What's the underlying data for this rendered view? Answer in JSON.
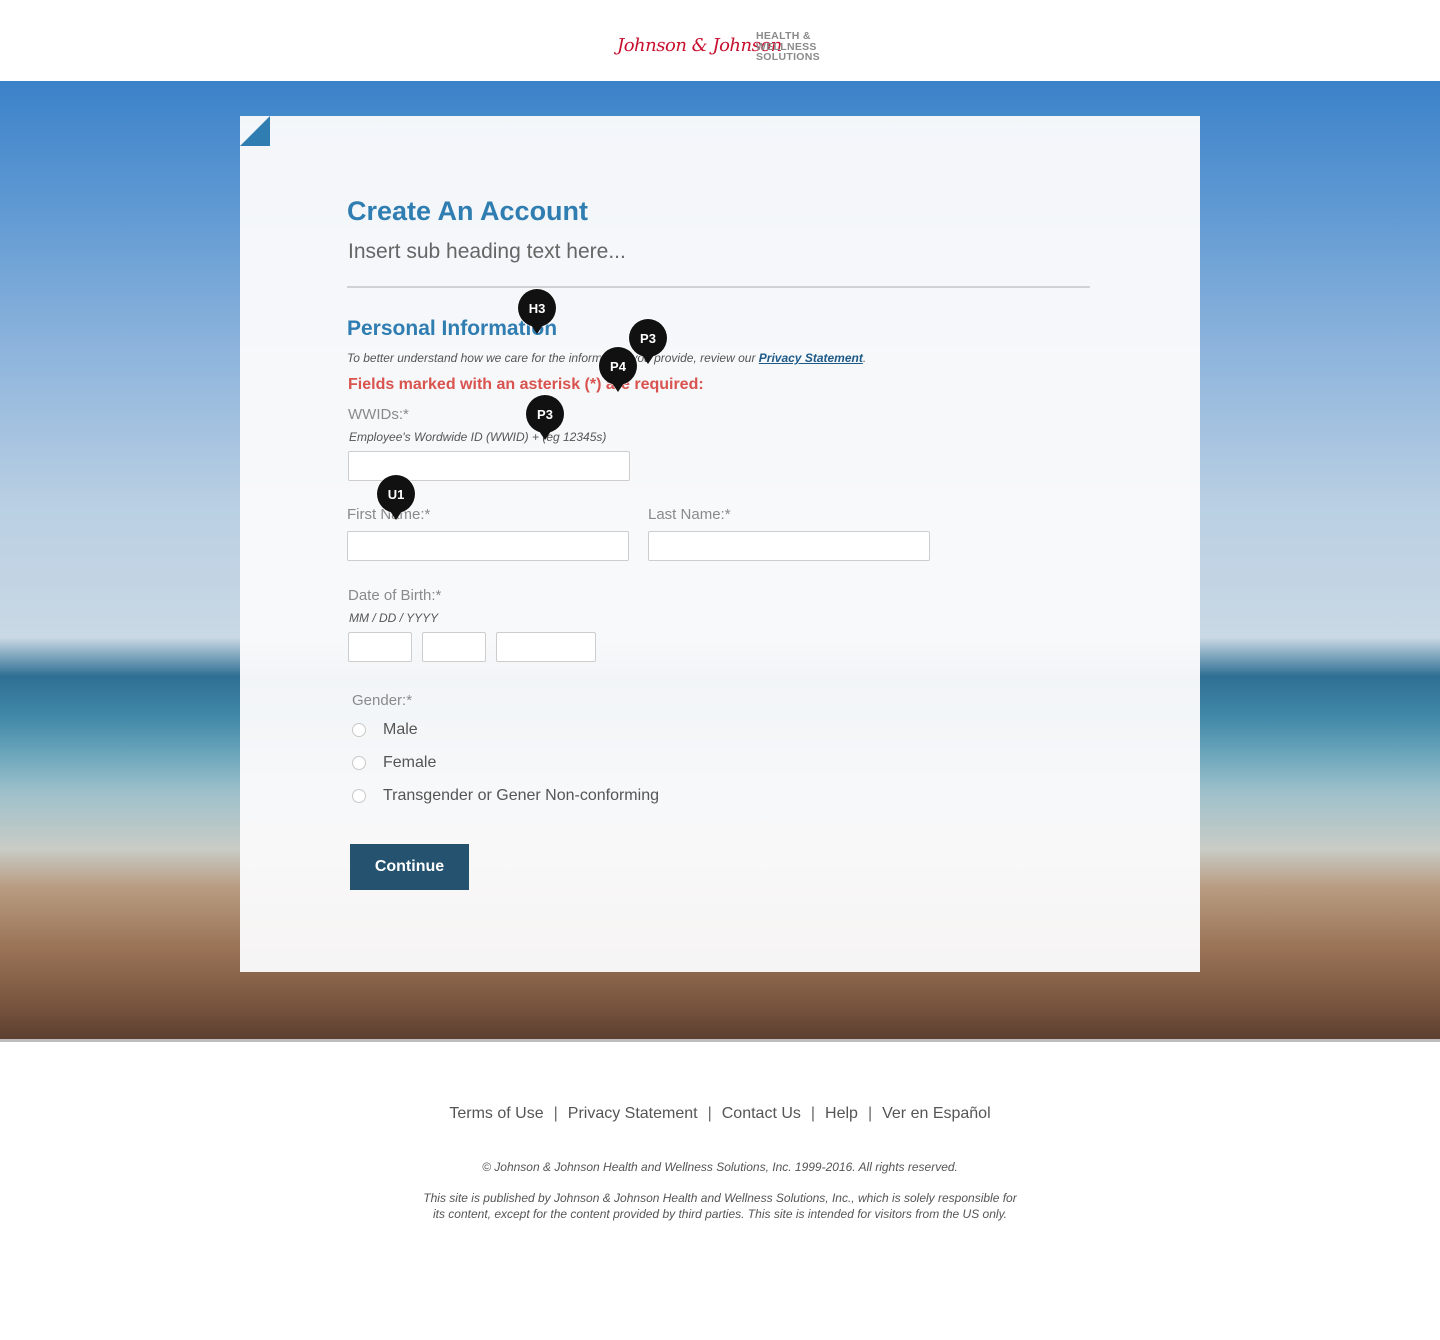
{
  "header": {
    "logo_script": "Johnson & Johnson",
    "logo_sub": [
      "HEALTH &",
      "WELLNESS",
      "SOLUTIONS"
    ]
  },
  "form": {
    "title": "Create An Account",
    "subheading": "Insert sub heading text here...",
    "section_title": "Personal Information",
    "privacy_note_prefix": "To better understand how we care for the information you provide, review our ",
    "privacy_link": "Privacy Statement",
    "privacy_note_suffix": ".",
    "required_note": "Fields marked with an asterisk (*) are required:",
    "wwid_label": "WWIDs:*",
    "wwid_hint": "Employee's Wordwide ID (WWID) + (eg 12345s)",
    "first_name_label": "First Name:*",
    "last_name_label": "Last Name:*",
    "dob_label": "Date of Birth:*",
    "dob_hint": "MM / DD / YYYY",
    "gender_label": "Gender:*",
    "gender_options": [
      "Male",
      "Female",
      "Transgender or Gener Non-conforming"
    ],
    "continue_label": "Continue"
  },
  "annotations": [
    "H3",
    "P3",
    "P4",
    "P3",
    "U1"
  ],
  "footer": {
    "links": [
      "Terms of Use",
      "Privacy Statement",
      "Contact Us",
      "Help",
      "Ver en Español"
    ],
    "separator": "|",
    "copyright": "© Johnson & Johnson Health and Wellness Solutions, Inc. 1999-2016. All rights reserved.",
    "disclaimer": "This site is published by Johnson & Johnson Health and Wellness Solutions, Inc., which is solely responsible for its content, except for the content provided by third parties.  This site is intended for visitors from the US only."
  },
  "colors": {
    "accent": "#2f7db1",
    "required": "#d9534f",
    "button": "#25526e",
    "logo_red": "#c8102e"
  }
}
